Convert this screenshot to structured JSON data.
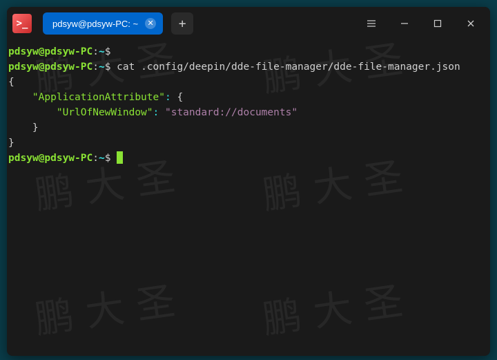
{
  "titlebar": {
    "tab_label": "pdsyw@pdsyw-PC: ~",
    "new_tab_label": "+"
  },
  "prompt": {
    "user_host": "pdsyw@pdsyw-PC",
    "separator": ":",
    "cwd": "~",
    "symbol": "$"
  },
  "lines": {
    "cmd1": "",
    "cmd2": "cat .config/deepin/dde-file-manager/dde-file-manager.json"
  },
  "json_output": {
    "open": "{",
    "indent1": "    ",
    "key1": "\"ApplicationAttribute\"",
    "colon": ":",
    "open2": " {",
    "indent2": "        ",
    "key2": "\"UrlOfNewWindow\"",
    "val2": " \"standard://documents\"",
    "close2": "    }",
    "close": "}"
  },
  "watermark_text": "鹏大圣",
  "colors": {
    "accent_tab": "#0066cc",
    "prompt_user": "#8ae234",
    "prompt_path": "#34e2e2",
    "json_string": "#ad7fa8"
  }
}
